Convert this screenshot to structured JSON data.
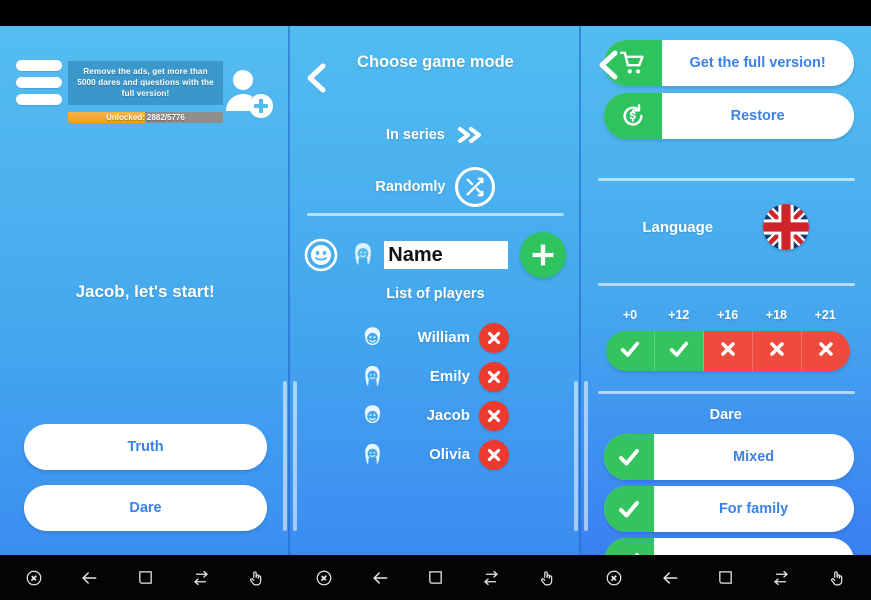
{
  "left_panel": {
    "menu_icon": "hamburger-menu-icon",
    "promo_text": "Remove the ads, get more than 5000 dares and questions with the full version!",
    "progress": {
      "label": "Unlocked: 2882/5776",
      "unlocked": 2882,
      "total": 5776,
      "percent": 49.9
    },
    "add_player_icon": "add-user-icon",
    "greeting": "Jacob, let's start!",
    "truth_button": "Truth",
    "dare_button": "Dare"
  },
  "middle_panel": {
    "back_icon": "back-chevron-icon",
    "title": "Choose game mode",
    "mode_series": {
      "label": "In series",
      "icon": "double-chevron-right-icon"
    },
    "mode_random": {
      "label": "Randomly",
      "icon": "shuffle-icon"
    },
    "gender_toggle_icon": "gender-toggle-icon",
    "new_player_avatar_icon": "female-avatar-icon",
    "name_input_value": "Name",
    "name_input_placeholder": "Name",
    "add_button_icon": "plus-icon",
    "list_caption": "List of players",
    "players": [
      {
        "name": "William",
        "gender": "male",
        "avatar_icon": "male-avatar-icon",
        "delete_icon": "close-x-icon"
      },
      {
        "name": "Emily",
        "gender": "female",
        "avatar_icon": "female-avatar-icon",
        "delete_icon": "close-x-icon"
      },
      {
        "name": "Jacob",
        "gender": "male",
        "avatar_icon": "male-avatar-icon",
        "delete_icon": "close-x-icon"
      },
      {
        "name": "Olivia",
        "gender": "female",
        "avatar_icon": "female-avatar-icon",
        "delete_icon": "close-x-icon"
      }
    ]
  },
  "right_panel": {
    "back_icon": "back-chevron-icon",
    "full_version": {
      "label": "Get the full version!",
      "icon": "shopping-cart-icon"
    },
    "restore": {
      "label": "Restore",
      "icon": "restore-purchase-icon"
    },
    "language": {
      "label": "Language",
      "flag": "uk-flag-icon",
      "value": "English"
    },
    "age_filter": [
      {
        "label": "+0",
        "enabled": true,
        "icon": "check-icon"
      },
      {
        "label": "+12",
        "enabled": true,
        "icon": "check-icon"
      },
      {
        "label": "+16",
        "enabled": false,
        "icon": "close-x-icon"
      },
      {
        "label": "+18",
        "enabled": false,
        "icon": "close-x-icon"
      },
      {
        "label": "+21",
        "enabled": false,
        "icon": "close-x-icon"
      }
    ],
    "dare_section_title": "Dare",
    "dare_options": [
      {
        "label": "Mixed",
        "checked": true
      },
      {
        "label": "For family",
        "checked": true
      },
      {
        "label": "",
        "checked": true
      }
    ]
  },
  "navbar": {
    "icons": [
      "screenshot-icon",
      "back-arrow-icon",
      "home-square-icon",
      "switch-app-icon",
      "touch-pointer-icon"
    ],
    "group_count": 3
  },
  "colors": {
    "panel_top": "#53bcf0",
    "panel_bottom": "#3a8cf2",
    "accent_blue_text": "#3b82e8",
    "green": "#2fc35f",
    "green_check": "#33c45e",
    "red": "#ec3a2e",
    "red_off": "#ef4a3c",
    "orange_progress": "#f0a52c",
    "white": "#ffffff",
    "black": "#000000"
  }
}
